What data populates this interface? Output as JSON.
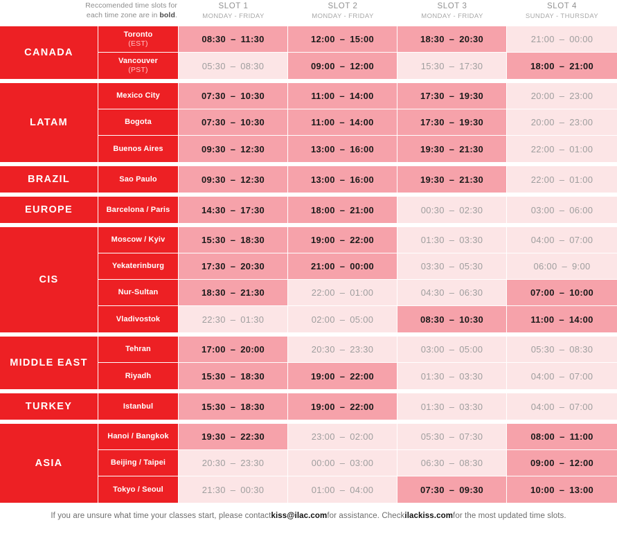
{
  "header": {
    "note_line1": "Reccomended time slots for",
    "note_line2_pre": "each time zone are in ",
    "note_line2_bold": "bold",
    "note_line2_post": ".",
    "slots": [
      {
        "title": "SLOT 1",
        "days": "MONDAY - FRIDAY"
      },
      {
        "title": "SLOT 2",
        "days": "MONDAY - FRIDAY"
      },
      {
        "title": "SLOT 3",
        "days": "MONDAY - FRIDAY"
      },
      {
        "title": "SLOT 4",
        "days": "SUNDAY - THURSDAY"
      }
    ]
  },
  "colors": {
    "brand_red": "#ED2024",
    "cell_on": "#F6A2AA",
    "cell_off": "#FCE5E6",
    "text_on": "#1a1a1a",
    "text_off": "#9e9e9e"
  },
  "regions": [
    {
      "name": "CANADA",
      "rows": [
        {
          "city": "Toronto",
          "tz": "(EST)",
          "slots": [
            {
              "start": "08:30",
              "end": "11:30",
              "recommended": true
            },
            {
              "start": "12:00",
              "end": "15:00",
              "recommended": true
            },
            {
              "start": "18:30",
              "end": "20:30",
              "recommended": true
            },
            {
              "start": "21:00",
              "end": "00:00",
              "recommended": false
            }
          ]
        },
        {
          "city": "Vancouver",
          "tz": "(PST)",
          "slots": [
            {
              "start": "05:30",
              "end": "08:30",
              "recommended": false
            },
            {
              "start": "09:00",
              "end": "12:00",
              "recommended": true
            },
            {
              "start": "15:30",
              "end": "17:30",
              "recommended": false
            },
            {
              "start": "18:00",
              "end": "21:00",
              "recommended": true
            }
          ]
        }
      ]
    },
    {
      "name": "LATAM",
      "rows": [
        {
          "city": "Mexico City",
          "tz": "",
          "slots": [
            {
              "start": "07:30",
              "end": "10:30",
              "recommended": true
            },
            {
              "start": "11:00",
              "end": "14:00",
              "recommended": true
            },
            {
              "start": "17:30",
              "end": "19:30",
              "recommended": true
            },
            {
              "start": "20:00",
              "end": "23:00",
              "recommended": false
            }
          ]
        },
        {
          "city": "Bogota",
          "tz": "",
          "slots": [
            {
              "start": "07:30",
              "end": "10:30",
              "recommended": true
            },
            {
              "start": "11:00",
              "end": "14:00",
              "recommended": true
            },
            {
              "start": "17:30",
              "end": "19:30",
              "recommended": true
            },
            {
              "start": "20:00",
              "end": "23:00",
              "recommended": false
            }
          ]
        },
        {
          "city": "Buenos Aires",
          "tz": "",
          "slots": [
            {
              "start": "09:30",
              "end": "12:30",
              "recommended": true
            },
            {
              "start": "13:00",
              "end": "16:00",
              "recommended": true
            },
            {
              "start": "19:30",
              "end": "21:30",
              "recommended": true
            },
            {
              "start": "22:00",
              "end": "01:00",
              "recommended": false
            }
          ]
        }
      ]
    },
    {
      "name": "BRAZIL",
      "rows": [
        {
          "city": "Sao Paulo",
          "tz": "",
          "slots": [
            {
              "start": "09:30",
              "end": "12:30",
              "recommended": true
            },
            {
              "start": "13:00",
              "end": "16:00",
              "recommended": true
            },
            {
              "start": "19:30",
              "end": "21:30",
              "recommended": true
            },
            {
              "start": "22:00",
              "end": "01:00",
              "recommended": false
            }
          ]
        }
      ]
    },
    {
      "name": "EUROPE",
      "rows": [
        {
          "city": "Barcelona / Paris",
          "tz": "",
          "slots": [
            {
              "start": "14:30",
              "end": "17:30",
              "recommended": true
            },
            {
              "start": "18:00",
              "end": "21:00",
              "recommended": true
            },
            {
              "start": "00:30",
              "end": "02:30",
              "recommended": false
            },
            {
              "start": "03:00",
              "end": "06:00",
              "recommended": false
            }
          ]
        }
      ]
    },
    {
      "name": "CIS",
      "rows": [
        {
          "city": "Moscow / Kyiv",
          "tz": "",
          "slots": [
            {
              "start": "15:30",
              "end": "18:30",
              "recommended": true
            },
            {
              "start": "19:00",
              "end": "22:00",
              "recommended": true
            },
            {
              "start": "01:30",
              "end": "03:30",
              "recommended": false
            },
            {
              "start": "04:00",
              "end": "07:00",
              "recommended": false
            }
          ]
        },
        {
          "city": "Yekaterinburg",
          "tz": "",
          "slots": [
            {
              "start": "17:30",
              "end": "20:30",
              "recommended": true
            },
            {
              "start": "21:00",
              "end": "00:00",
              "recommended": true
            },
            {
              "start": "03:30",
              "end": "05:30",
              "recommended": false
            },
            {
              "start": "06:00",
              "end": "9:00",
              "recommended": false
            }
          ]
        },
        {
          "city": "Nur-Sultan",
          "tz": "",
          "slots": [
            {
              "start": "18:30",
              "end": "21:30",
              "recommended": true
            },
            {
              "start": "22:00",
              "end": "01:00",
              "recommended": false
            },
            {
              "start": "04:30",
              "end": "06:30",
              "recommended": false
            },
            {
              "start": "07:00",
              "end": "10:00",
              "recommended": true
            }
          ]
        },
        {
          "city": "Vladivostok",
          "tz": "",
          "slots": [
            {
              "start": "22:30",
              "end": "01:30",
              "recommended": false
            },
            {
              "start": "02:00",
              "end": "05:00",
              "recommended": false
            },
            {
              "start": "08:30",
              "end": "10:30",
              "recommended": true
            },
            {
              "start": "11:00",
              "end": "14:00",
              "recommended": true
            }
          ]
        }
      ]
    },
    {
      "name": "MIDDLE EAST",
      "rows": [
        {
          "city": "Tehran",
          "tz": "",
          "slots": [
            {
              "start": "17:00",
              "end": "20:00",
              "recommended": true
            },
            {
              "start": "20:30",
              "end": "23:30",
              "recommended": false
            },
            {
              "start": "03:00",
              "end": "05:00",
              "recommended": false
            },
            {
              "start": "05:30",
              "end": "08:30",
              "recommended": false
            }
          ]
        },
        {
          "city": "Riyadh",
          "tz": "",
          "slots": [
            {
              "start": "15:30",
              "end": "18:30",
              "recommended": true
            },
            {
              "start": "19:00",
              "end": "22:00",
              "recommended": true
            },
            {
              "start": "01:30",
              "end": "03:30",
              "recommended": false
            },
            {
              "start": "04:00",
              "end": "07:00",
              "recommended": false
            }
          ]
        }
      ]
    },
    {
      "name": "TURKEY",
      "rows": [
        {
          "city": "Istanbul",
          "tz": "",
          "slots": [
            {
              "start": "15:30",
              "end": "18:30",
              "recommended": true
            },
            {
              "start": "19:00",
              "end": "22:00",
              "recommended": true
            },
            {
              "start": "01:30",
              "end": "03:30",
              "recommended": false
            },
            {
              "start": "04:00",
              "end": "07:00",
              "recommended": false
            }
          ]
        }
      ]
    },
    {
      "name": "ASIA",
      "rows": [
        {
          "city": "Hanoi / Bangkok",
          "tz": "",
          "slots": [
            {
              "start": "19:30",
              "end": "22:30",
              "recommended": true
            },
            {
              "start": "23:00",
              "end": "02:00",
              "recommended": false
            },
            {
              "start": "05:30",
              "end": "07:30",
              "recommended": false
            },
            {
              "start": "08:00",
              "end": "11:00",
              "recommended": true
            }
          ]
        },
        {
          "city": "Beijing / Taipei",
          "tz": "",
          "slots": [
            {
              "start": "20:30",
              "end": "23:30",
              "recommended": false
            },
            {
              "start": "00:00",
              "end": "03:00",
              "recommended": false
            },
            {
              "start": "06:30",
              "end": "08:30",
              "recommended": false
            },
            {
              "start": "09:00",
              "end": "12:00",
              "recommended": true
            }
          ]
        },
        {
          "city": "Tokyo / Seoul",
          "tz": "",
          "slots": [
            {
              "start": "21:30",
              "end": "00:30",
              "recommended": false
            },
            {
              "start": "01:00",
              "end": "04:00",
              "recommended": false
            },
            {
              "start": "07:30",
              "end": "09:30",
              "recommended": true
            },
            {
              "start": "10:00",
              "end": "13:00",
              "recommended": true
            }
          ]
        }
      ]
    }
  ],
  "footer": {
    "part1": "If you are unsure what time your classes start, please contact ",
    "email": "kiss@ilac.com",
    "part2": " for assistance. Check ",
    "website": "ilackiss.com",
    "part3": " for the most updated time slots."
  },
  "dash": "–"
}
